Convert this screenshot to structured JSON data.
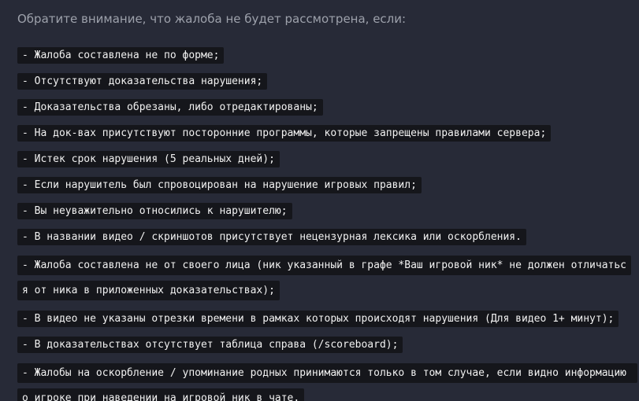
{
  "intro": "Обратите внимание, что жалоба не будет рассмотрена, если:",
  "rules": [
    "- Жалоба составлена не по форме;",
    "- Отсутствуют доказательства нарушения;",
    "- Доказательства обрезаны, либо отредактированы;",
    "- На док-вах присутствуют посторонние программы, которые запрещены правилами сервера;",
    "- Истек срок нарушения (5 реальных дней);",
    "- Если нарушитель был спровоцирован на нарушение игровых правил;",
    "- Вы неуважительно относились к нарушителю;",
    "- В названии видео / скриншотов присутствует нецензурная лексика или оскорбления.",
    "- Жалоба составлена не от своего лица (ник указанный в графе *Ваш игровой ник* не должен отличаться от ника в приложенных доказательствах);",
    "- В видео не указаны отрезки времени в рамках которых происходят нарушения (Для видео 1+ минут);",
    "- В доказательствах отсутствует таблица справа (/scoreboard);",
    "- Жалобы на оскорбление / упоминание родных принимаются только в том случае, если видно информацию о игроке при наведении на игровой ник в чате."
  ]
}
